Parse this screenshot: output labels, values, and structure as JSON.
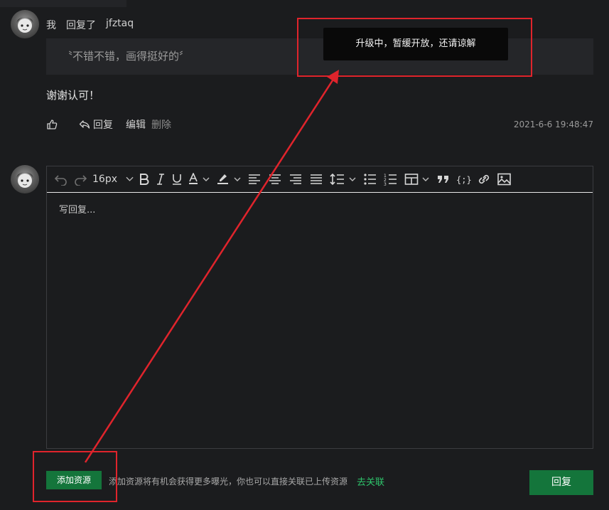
{
  "comment": {
    "author": "我",
    "replied_label": "回复了",
    "target_user": "jfztaq",
    "quote": "〝不错不错，画得挺好的〞",
    "reply_text": "谢谢认可！",
    "actions": {
      "reply": "回复",
      "edit": "编辑",
      "delete": "删除"
    },
    "timestamp": "2021-6-6 19:48:47"
  },
  "editor": {
    "font_size": "16px",
    "placeholder": "写回复...",
    "toolbar_icons": [
      "undo-icon",
      "redo-icon",
      "font-size-dropdown",
      "bold-icon",
      "italic-icon",
      "underline-icon",
      "font-color-icon",
      "highlight-icon",
      "align-left-icon",
      "align-center-icon",
      "align-right-icon",
      "align-justify-icon",
      "line-height-icon",
      "bullet-list-icon",
      "numbered-list-icon",
      "table-icon",
      "quote-icon",
      "code-icon",
      "link-icon",
      "image-icon"
    ]
  },
  "footer": {
    "add_resource": "添加资源",
    "hint": "添加资源将有机会获得更多曝光，你也可以直接关联已上传资源",
    "link": "去关联",
    "reply_button": "回复"
  },
  "tooltip": "升级中，暂缓开放，还请谅解",
  "colors": {
    "background": "#1b1c1e",
    "accent_green": "#14753b",
    "link_green": "#2ec36b",
    "annotation_red": "#e0242c"
  }
}
